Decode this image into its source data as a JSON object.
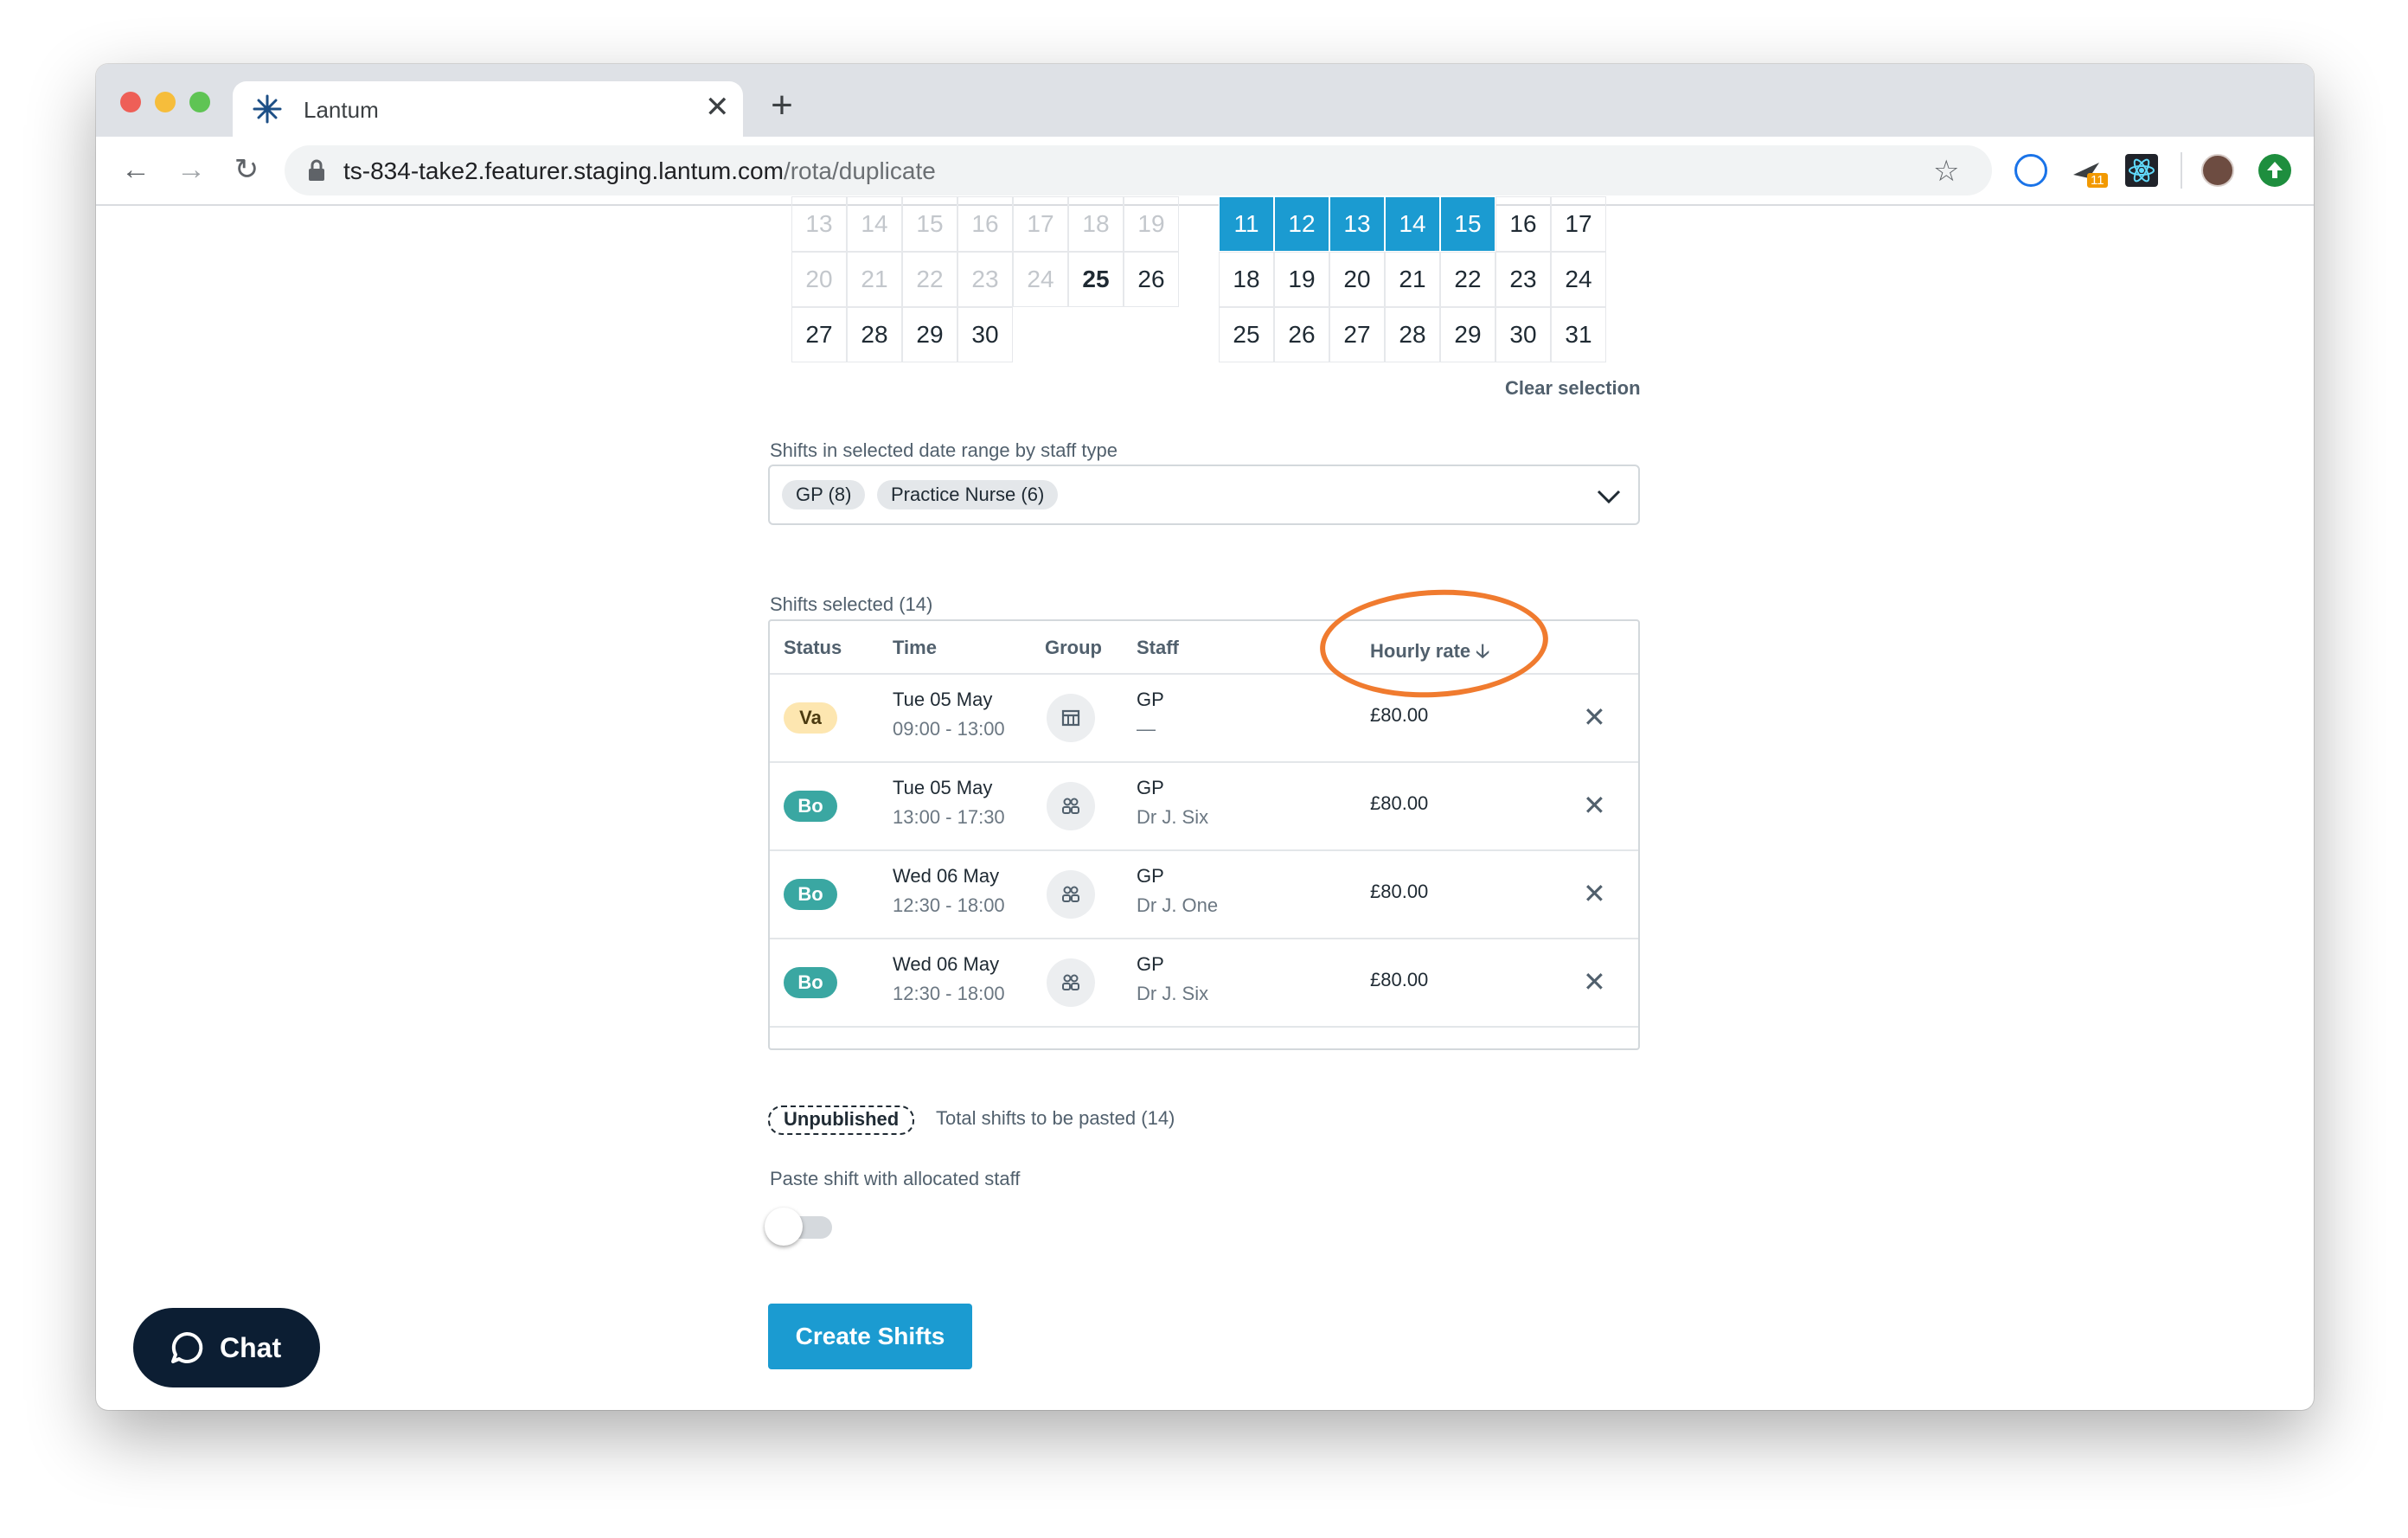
{
  "browser": {
    "tab_title": "Lantum",
    "url_host": "ts-834-take2.featurer.staging.lantum.com",
    "url_path": "/rota/duplicate",
    "extension_badge": "11"
  },
  "calendar_left": {
    "rows": [
      [
        {
          "d": "13",
          "s": "dim"
        },
        {
          "d": "14",
          "s": "dim"
        },
        {
          "d": "15",
          "s": "dim"
        },
        {
          "d": "16",
          "s": "dim"
        },
        {
          "d": "17",
          "s": "dim"
        },
        {
          "d": "18",
          "s": "dim"
        },
        {
          "d": "19",
          "s": "dim"
        }
      ],
      [
        {
          "d": "20",
          "s": "dim"
        },
        {
          "d": "21",
          "s": "dim"
        },
        {
          "d": "22",
          "s": "dim"
        },
        {
          "d": "23",
          "s": "dim"
        },
        {
          "d": "24",
          "s": "dim"
        },
        {
          "d": "25",
          "s": "bold"
        },
        {
          "d": "26",
          "s": "norm"
        }
      ],
      [
        {
          "d": "27",
          "s": "norm"
        },
        {
          "d": "28",
          "s": "norm"
        },
        {
          "d": "29",
          "s": "norm"
        },
        {
          "d": "30",
          "s": "norm"
        }
      ]
    ]
  },
  "calendar_right": {
    "rows": [
      [
        {
          "d": "11",
          "s": "sel"
        },
        {
          "d": "12",
          "s": "sel"
        },
        {
          "d": "13",
          "s": "sel"
        },
        {
          "d": "14",
          "s": "sel"
        },
        {
          "d": "15",
          "s": "sel"
        },
        {
          "d": "16",
          "s": "norm"
        },
        {
          "d": "17",
          "s": "norm"
        }
      ],
      [
        {
          "d": "18",
          "s": "norm"
        },
        {
          "d": "19",
          "s": "norm"
        },
        {
          "d": "20",
          "s": "norm"
        },
        {
          "d": "21",
          "s": "norm"
        },
        {
          "d": "22",
          "s": "norm"
        },
        {
          "d": "23",
          "s": "norm"
        },
        {
          "d": "24",
          "s": "norm"
        }
      ],
      [
        {
          "d": "25",
          "s": "norm"
        },
        {
          "d": "26",
          "s": "norm"
        },
        {
          "d": "27",
          "s": "norm"
        },
        {
          "d": "28",
          "s": "norm"
        },
        {
          "d": "29",
          "s": "norm"
        },
        {
          "d": "30",
          "s": "norm"
        },
        {
          "d": "31",
          "s": "norm"
        }
      ]
    ]
  },
  "clear_selection": "Clear selection",
  "staff_type": {
    "label": "Shifts in selected date range by staff type",
    "chips": [
      "GP (8)",
      "Practice Nurse (6)"
    ]
  },
  "shifts": {
    "label": "Shifts selected (14)",
    "headers": {
      "status": "Status",
      "time": "Time",
      "group": "Group",
      "staff": "Staff",
      "rate": "Hourly rate"
    },
    "rows": [
      {
        "status": "Va",
        "status_kind": "va",
        "date": "Tue 05 May",
        "time": "09:00 - 13:00",
        "group_icon": "building-icon",
        "staff_type": "GP",
        "staff_name": "—",
        "rate": "£80.00"
      },
      {
        "status": "Bo",
        "status_kind": "bo",
        "date": "Tue 05 May",
        "time": "13:00 - 17:30",
        "group_icon": "people-icon",
        "staff_type": "GP",
        "staff_name": "Dr J. Six",
        "rate": "£80.00"
      },
      {
        "status": "Bo",
        "status_kind": "bo",
        "date": "Wed 06 May",
        "time": "12:30 - 18:00",
        "group_icon": "people-icon",
        "staff_type": "GP",
        "staff_name": "Dr J. One",
        "rate": "£80.00"
      },
      {
        "status": "Bo",
        "status_kind": "bo",
        "date": "Wed 06 May",
        "time": "12:30 - 18:00",
        "group_icon": "people-icon",
        "staff_type": "GP",
        "staff_name": "Dr J. Six",
        "rate": "£80.00"
      }
    ]
  },
  "footer": {
    "unpublished": "Unpublished",
    "total": "Total shifts to be pasted (14)",
    "toggle_label": "Paste shift with allocated staff",
    "toggle_on": false,
    "create_button": "Create Shifts"
  },
  "chat": {
    "label": "Chat"
  },
  "colors": {
    "accent": "#1b9bd1",
    "annotation": "#f07b2f",
    "badge_va": "#fde6b0",
    "badge_bo": "#3aa7a2",
    "chat_bg": "#0c1e33"
  }
}
